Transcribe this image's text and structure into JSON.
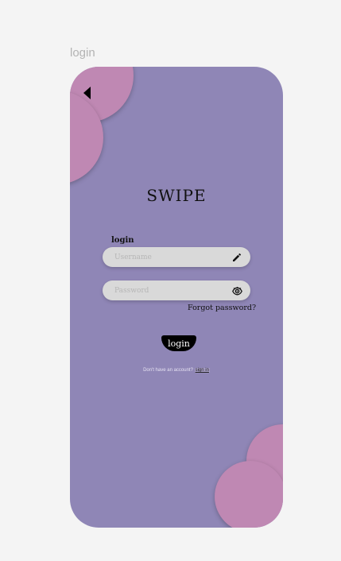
{
  "frame": {
    "label": "login"
  },
  "screen": {
    "title": "SWIPE",
    "username_label": "login",
    "username_placeholder": "Username",
    "password_placeholder": "Password",
    "forgot_password": "Forgot password?",
    "login_button": "login",
    "no_account_text": "Don't have an account?",
    "sign_in_link": "sign in"
  },
  "icons": {
    "back": "back-arrow-icon",
    "username": "pencil-icon",
    "password": "eye-icon"
  },
  "colors": {
    "page_bg": "#f4f4f4",
    "phone_bg": "#8f86b6",
    "blob": "#bf88b3",
    "field_bg": "#d9d9d9",
    "button_bg": "#000000"
  }
}
